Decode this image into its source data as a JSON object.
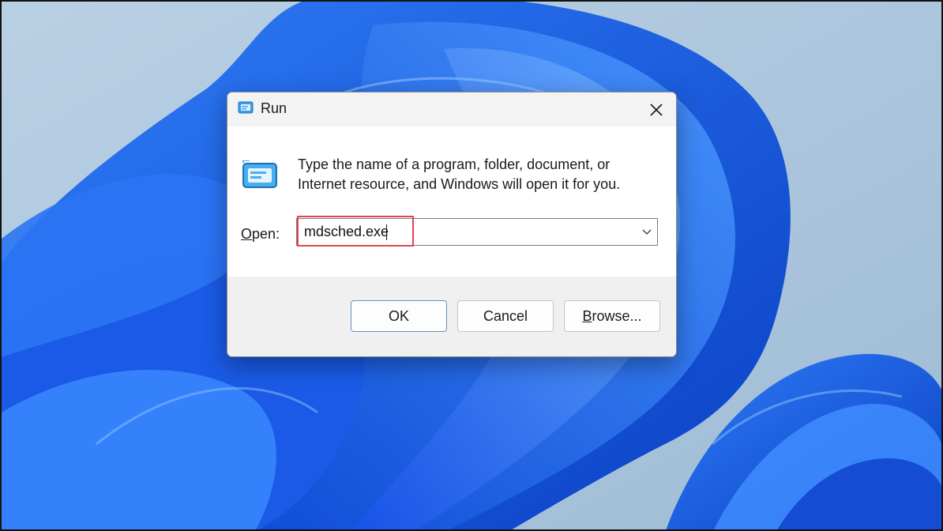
{
  "dialog": {
    "title": "Run",
    "description": "Type the name of a program, folder, document, or Internet resource, and Windows will open it for you.",
    "open_label_first": "O",
    "open_label_rest": "pen:",
    "input_value": "mdsched.exe"
  },
  "buttons": {
    "ok": "OK",
    "cancel": "Cancel",
    "browse_first": "B",
    "browse_rest": "rowse..."
  },
  "icons": {
    "app": "run-icon",
    "close": "close-icon",
    "dropdown": "chevron-down-icon"
  },
  "colors": {
    "highlight": "#e0464f",
    "wallpaper_bg": "#a9c4db",
    "bloom": "#1f63e0"
  }
}
